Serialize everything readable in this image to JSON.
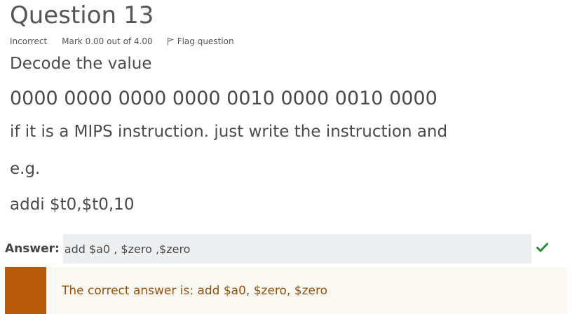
{
  "question": {
    "title_prefix": "Question",
    "number": "13",
    "state": "Incorrect",
    "grade": "Mark 0.00 out of 4.00",
    "flag_label": "Flag question",
    "text_lines": [
      "Decode the value",
      "0000 0000 0000 0000 0010 0000 0010 0000",
      "if it is a MIPS instruction. just write the instruction and",
      "e.g.",
      "addi $t0,$t0,10"
    ]
  },
  "answer": {
    "label": "Answer:",
    "value": "add $a0 , $zero ,$zero"
  },
  "feedback": {
    "right_answer": "The correct answer is: add $a0, $zero, $zero",
    "accent_color": "#b85a0a",
    "check_color": "#2e8b3a"
  },
  "icons": {
    "flag": "flag-icon",
    "check": "check-icon"
  }
}
